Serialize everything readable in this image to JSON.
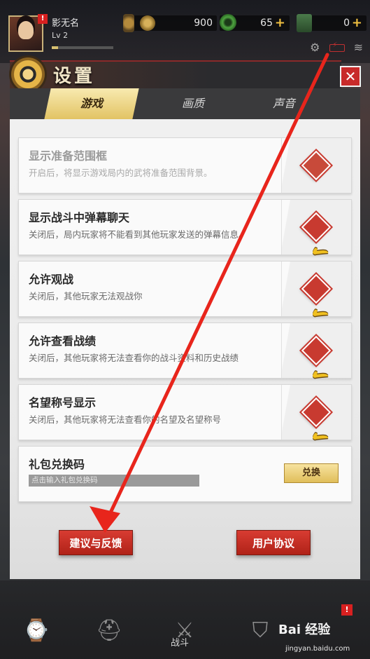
{
  "player": {
    "name": "影无名",
    "level": "Lv 2",
    "alert": "!",
    "xp_progress": 0.1
  },
  "currencies": [
    {
      "name": "coin",
      "icon": "coin-icon",
      "value": "900"
    },
    {
      "name": "jade",
      "icon": "jade-icon",
      "value": "65",
      "plus": "+"
    },
    {
      "name": "ticket",
      "icon": "ticket-icon",
      "value": "0",
      "plus": "+"
    }
  ],
  "settings": {
    "title": "设置",
    "close_label": "✕",
    "tabs": [
      {
        "label": "游戏",
        "active": true
      },
      {
        "label": "画质",
        "active": false
      },
      {
        "label": "声音",
        "active": false
      }
    ],
    "options": [
      {
        "title": "显示准备范围框",
        "desc": "开启后，将显示游戏局内的武将准备范围背景。",
        "state": "off",
        "enabled": false
      },
      {
        "title": "显示战斗中弹幕聊天",
        "desc": "关闭后，局内玩家将不能看到其他玩家发送的弹幕信息。",
        "state": "on",
        "enabled": true
      },
      {
        "title": "允许观战",
        "desc": "关闭后，其他玩家无法观战你",
        "state": "on",
        "enabled": true
      },
      {
        "title": "允许查看战绩",
        "desc": "关闭后，其他玩家将无法查看你的战斗资料和历史战绩",
        "state": "on",
        "enabled": true
      },
      {
        "title": "名望称号显示",
        "desc": "关闭后，其他玩家将无法查看你的名望及名望称号",
        "state": "on",
        "enabled": true
      }
    ],
    "redeem": {
      "title": "礼包兑换码",
      "placeholder": "点击输入礼包兑换码",
      "button": "兑换"
    },
    "feedback_button": "建议与反馈",
    "agreement_button": "用户协议"
  },
  "bottom_nav": {
    "items": [
      {
        "icon": "watch-icon"
      },
      {
        "icon": "helmet-icon"
      },
      {
        "icon": "crossed-swords-icon",
        "label": "战斗"
      },
      {
        "icon": "banner-icon"
      }
    ],
    "alert": "!"
  },
  "watermark": {
    "brand": "Bai 经验",
    "url": "jingyan.baidu.com"
  },
  "colors": {
    "accent_gold": "#e2c364",
    "danger_red": "#c83a30",
    "annotation_arrow": "#e8251c"
  }
}
